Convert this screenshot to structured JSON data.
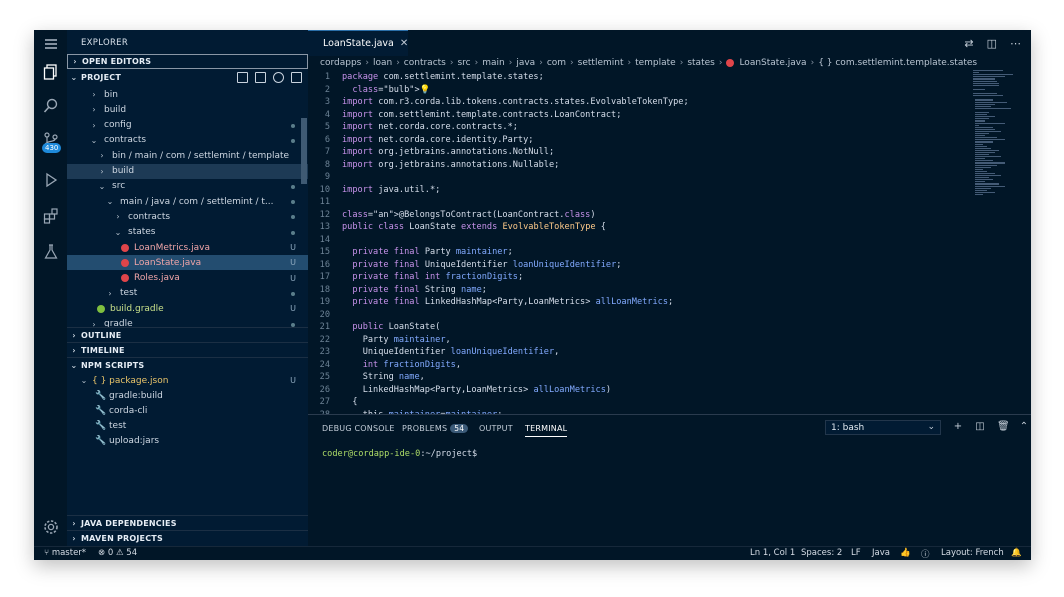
{
  "colors": {
    "window_bg": "#011627",
    "sidebar_bg": "#011b33",
    "selection": "#234d70",
    "accent": "#1e8adb",
    "keyword": "#c792ea",
    "type": "#ffcb8b",
    "identifier": "#82aaff",
    "annotation": "#addb67"
  },
  "activity": {
    "scm_badge": "430"
  },
  "sidebar": {
    "title": "EXPLORER",
    "open_editors": "OPEN EDITORS",
    "project": "PROJECT",
    "tree": [
      {
        "label": "bin",
        "depth": 1,
        "chev": "›"
      },
      {
        "label": "build",
        "depth": 1,
        "chev": "›"
      },
      {
        "label": "config",
        "depth": 1,
        "chev": "›"
      },
      {
        "label": "contracts",
        "depth": 1,
        "chev": "⌄"
      },
      {
        "label": "bin / main / com / settlemint / template",
        "depth": 2,
        "chev": "›"
      },
      {
        "label": "build",
        "depth": 2,
        "chev": "›"
      },
      {
        "label": "src",
        "depth": 2,
        "chev": "⌄"
      },
      {
        "label": "main / java / com / settlemint / t...",
        "depth": 3,
        "chev": "⌄"
      },
      {
        "label": "contracts",
        "depth": 4,
        "chev": "›"
      },
      {
        "label": "states",
        "depth": 4,
        "chev": "⌄"
      },
      {
        "label": "LoanMetrics.java",
        "depth": 5,
        "decoration": "U"
      },
      {
        "label": "LoanState.java",
        "depth": 5,
        "decoration": "U"
      },
      {
        "label": "Roles.java",
        "depth": 5,
        "decoration": "U"
      },
      {
        "label": "test",
        "depth": 3,
        "chev": "›"
      },
      {
        "label": "build.gradle",
        "depth": 2,
        "decoration": "U"
      },
      {
        "label": "gradle",
        "depth": 1,
        "chev": "›"
      }
    ],
    "outline": "OUTLINE",
    "timeline": "TIMELINE",
    "npm_scripts": "NPM SCRIPTS",
    "package_json": "{ } package.json",
    "package_decoration": "U",
    "scripts": [
      "gradle:build",
      "corda-cli",
      "test",
      "upload:jars"
    ],
    "java_deps": "JAVA DEPENDENCIES",
    "maven": "MAVEN PROJECTS"
  },
  "editor": {
    "tab_name": "LoanState.java",
    "breadcrumbs": [
      "cordapps",
      "loan",
      "contracts",
      "src",
      "main",
      "java",
      "com",
      "settlemint",
      "template",
      "states",
      "LoanState.java",
      "{ } com.settlemint.template.states"
    ],
    "lines": [
      {
        "n": "1",
        "t": "package com.settlemint.template.states;"
      },
      {
        "n": "2",
        "t": "  💡"
      },
      {
        "n": "3",
        "t": "import com.r3.corda.lib.tokens.contracts.states.EvolvableTokenType;"
      },
      {
        "n": "4",
        "t": "import com.settlemint.template.contracts.LoanContract;"
      },
      {
        "n": "5",
        "t": "import net.corda.core.contracts.*;"
      },
      {
        "n": "6",
        "t": "import net.corda.core.identity.Party;"
      },
      {
        "n": "7",
        "t": "import org.jetbrains.annotations.NotNull;"
      },
      {
        "n": "8",
        "t": "import org.jetbrains.annotations.Nullable;"
      },
      {
        "n": "9",
        "t": ""
      },
      {
        "n": "10",
        "t": "import java.util.*;"
      },
      {
        "n": "11",
        "t": ""
      },
      {
        "n": "12",
        "t": "@BelongsToContract(LoanContract.class)"
      },
      {
        "n": "13",
        "t": "public class LoanState extends EvolvableTokenType {"
      },
      {
        "n": "14",
        "t": ""
      },
      {
        "n": "15",
        "t": "  private final Party maintainer;"
      },
      {
        "n": "16",
        "t": "  private final UniqueIdentifier loanUniqueIdentifier;"
      },
      {
        "n": "17",
        "t": "  private final int fractionDigits;"
      },
      {
        "n": "18",
        "t": "  private final String name;"
      },
      {
        "n": "19",
        "t": "  private final LinkedHashMap<Party,LoanMetrics> allLoanMetrics;"
      },
      {
        "n": "20",
        "t": ""
      },
      {
        "n": "21",
        "t": "  public LoanState("
      },
      {
        "n": "22",
        "t": "    Party maintainer,"
      },
      {
        "n": "23",
        "t": "    UniqueIdentifier loanUniqueIdentifier,"
      },
      {
        "n": "24",
        "t": "    int fractionDigits,"
      },
      {
        "n": "25",
        "t": "    String name,"
      },
      {
        "n": "26",
        "t": "    LinkedHashMap<Party,LoanMetrics> allLoanMetrics)"
      },
      {
        "n": "27",
        "t": "  {"
      },
      {
        "n": "28",
        "t": "    this.maintainer=maintainer;"
      }
    ]
  },
  "panel": {
    "tabs": [
      "DEBUG CONSOLE",
      "PROBLEMS",
      "OUTPUT",
      "TERMINAL"
    ],
    "problems_count": "54",
    "terminal_select": "1: bash",
    "prompt_user": "coder@cordapp-ide-0",
    "prompt_path": ":~/project$"
  },
  "status": {
    "branch": "master*",
    "errors": "0",
    "warnings": "54",
    "position": "Ln 1, Col 1",
    "spaces": "Spaces: 2",
    "eol": "LF",
    "language": "Java",
    "layout": "Layout: French"
  }
}
